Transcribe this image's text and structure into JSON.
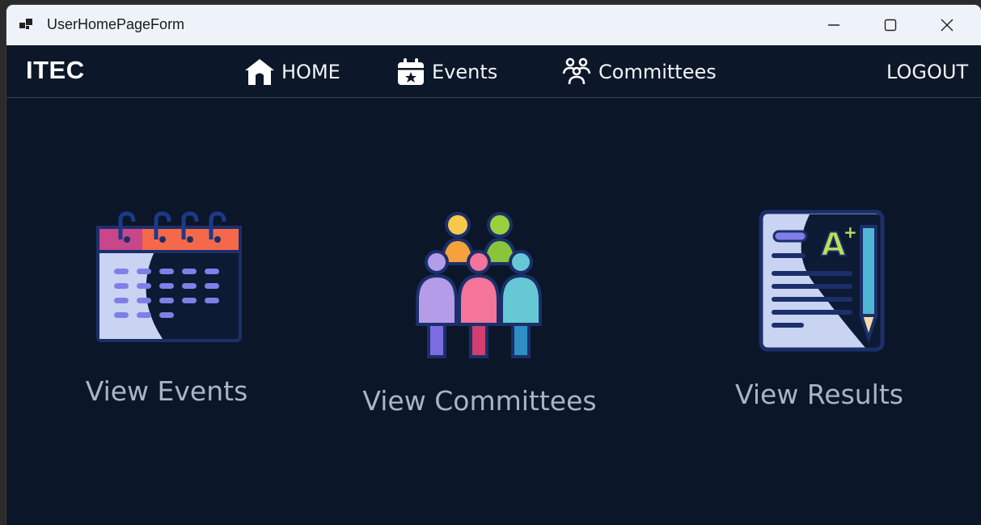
{
  "window": {
    "title": "UserHomePageForm",
    "controls": {
      "minimize_icon": "minimize-icon",
      "maximize_icon": "maximize-icon",
      "close_icon": "close-icon"
    }
  },
  "navbar": {
    "brand": "ITEC",
    "home_label": "HOME",
    "events_label": "Events",
    "committees_label": "Committees",
    "logout_label": "LOGOUT"
  },
  "tiles": [
    {
      "label": "View Events",
      "icon": "calendar-icon"
    },
    {
      "label": "View Committees",
      "icon": "people-group-icon"
    },
    {
      "label": "View Results",
      "icon": "graded-document-icon"
    }
  ],
  "colors": {
    "background": "#0b1628",
    "nav_text": "#f2f4f7",
    "tile_label": "#a9b4c4",
    "titlebar": "#eef3f9"
  }
}
